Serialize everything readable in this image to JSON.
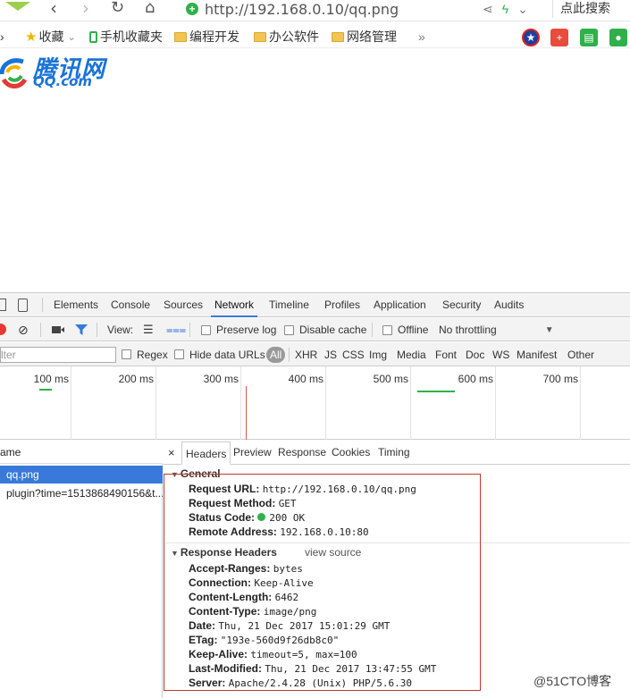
{
  "browser": {
    "url": "http://192.168.0.10/qq.png",
    "search_label": "点此搜索",
    "bookmarks": [
      {
        "label": "收藏"
      },
      {
        "label": "手机收藏夹"
      },
      {
        "label": "编程开发"
      },
      {
        "label": "办公软件"
      },
      {
        "label": "网络管理"
      }
    ],
    "more": "»"
  },
  "page": {
    "logo_cn": "腾讯网",
    "logo_en": "QQ.com"
  },
  "devtools": {
    "tabs": [
      "Elements",
      "Console",
      "Sources",
      "Network",
      "Timeline",
      "Profiles",
      "Application",
      "Security",
      "Audits"
    ],
    "active_tab": "Network",
    "toolbar": {
      "view_label": "View:",
      "preserve_log": "Preserve log",
      "disable_cache": "Disable cache",
      "offline": "Offline",
      "throttle": "No throttling"
    },
    "filter": {
      "placeholder": "lter",
      "regex": "Regex",
      "hide_data_urls": "Hide data URLs",
      "types": [
        "All",
        "XHR",
        "JS",
        "CSS",
        "Img",
        "Media",
        "Font",
        "Doc",
        "WS",
        "Manifest",
        "Other"
      ]
    },
    "timeline_ticks": [
      "100 ms",
      "200 ms",
      "300 ms",
      "400 ms",
      "500 ms",
      "600 ms",
      "700 ms"
    ],
    "request_list": {
      "header": "ame",
      "rows": [
        "qq.png",
        "plugin?time=1513868490156&t..."
      ]
    },
    "detail": {
      "tabs": [
        "Headers",
        "Preview",
        "Response",
        "Cookies",
        "Timing"
      ],
      "general": {
        "title": "General",
        "rows": [
          {
            "k": "Request URL:",
            "v": "http://192.168.0.10/qq.png"
          },
          {
            "k": "Request Method:",
            "v": "GET"
          },
          {
            "k": "Status Code:",
            "v": "200 OK"
          },
          {
            "k": "Remote Address:",
            "v": "192.168.0.10:80"
          }
        ]
      },
      "response": {
        "title": "Response Headers",
        "view_source": "view source",
        "rows": [
          {
            "k": "Accept-Ranges:",
            "v": "bytes"
          },
          {
            "k": "Connection:",
            "v": "Keep-Alive"
          },
          {
            "k": "Content-Length:",
            "v": "6462"
          },
          {
            "k": "Content-Type:",
            "v": "image/png"
          },
          {
            "k": "Date:",
            "v": "Thu, 21 Dec 2017 15:01:29 GMT"
          },
          {
            "k": "ETag:",
            "v": "\"193e-560d9f26db8c0\""
          },
          {
            "k": "Keep-Alive:",
            "v": "timeout=5, max=100"
          },
          {
            "k": "Last-Modified:",
            "v": "Thu, 21 Dec 2017 13:47:55 GMT"
          },
          {
            "k": "Server:",
            "v": "Apache/2.4.28 (Unix) PHP/5.6.30"
          }
        ]
      }
    }
  },
  "watermark": "@51CTO博客",
  "colors": {
    "accent": "#3879d9",
    "record": "#e53935",
    "ok": "#2fb14a",
    "highlight": "#c0392b"
  }
}
